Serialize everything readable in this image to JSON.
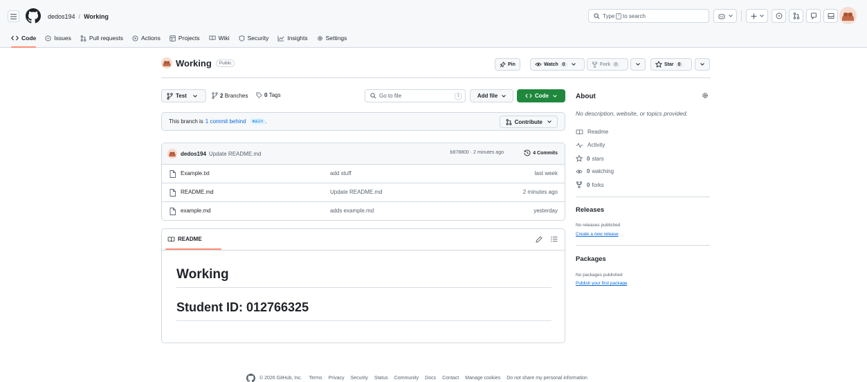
{
  "header": {
    "owner": "dedos194",
    "separator": "/",
    "repo": "Working",
    "search_prefix": "Type",
    "search_key": "/",
    "search_suffix": "to search"
  },
  "nav": {
    "code": "Code",
    "issues": "Issues",
    "pull_requests": "Pull requests",
    "actions": "Actions",
    "projects": "Projects",
    "wiki": "Wiki",
    "security": "Security",
    "insights": "Insights",
    "settings": "Settings"
  },
  "repo": {
    "name": "Working",
    "visibility": "Public",
    "pin_label": "Pin",
    "watch_label": "Watch",
    "watch_count": "0",
    "fork_label": "Fork",
    "fork_count": "0",
    "star_label": "Star",
    "star_count": "0"
  },
  "toolbar": {
    "branch": "Test",
    "branches_count": "2",
    "branches_label": "Branches",
    "tags_count": "0",
    "tags_label": "Tags",
    "goto_placeholder": "Go to file",
    "goto_key": "t",
    "add_file": "Add file",
    "code_label": "Code"
  },
  "behind_banner": {
    "prefix": "This branch is",
    "link": "1 commit behind",
    "branch": "main",
    "suffix": ".",
    "contribute": "Contribute"
  },
  "latest_commit": {
    "author": "dedos194",
    "message": "Update README.md",
    "meta": "b878800 · 2 minutes ago",
    "commits_count": "4",
    "commits_label": "Commits"
  },
  "files": [
    {
      "name": "Example.txt",
      "message": "add stuff",
      "date": "last week"
    },
    {
      "name": "README.md",
      "message": "Update README.md",
      "date": "2 minutes ago"
    },
    {
      "name": "example.md",
      "message": "adds example.md",
      "date": "yesterday"
    }
  ],
  "readme": {
    "tab": "README",
    "h1": "Working",
    "h2": "Student ID: 012766325"
  },
  "sidebar": {
    "about_title": "About",
    "about_desc": "No description, website, or topics provided.",
    "readme": "Readme",
    "activity": "Activity",
    "stars_count": "0",
    "stars_label": "stars",
    "watching_count": "0",
    "watching_label": "watching",
    "forks_count": "0",
    "forks_label": "forks",
    "releases_title": "Releases",
    "releases_none": "No releases published",
    "releases_link": "Create a new release",
    "packages_title": "Packages",
    "packages_none": "No packages published",
    "packages_link": "Publish your first package"
  },
  "footer": {
    "copyright": "© 2026 GitHub, Inc.",
    "links": [
      "Terms",
      "Privacy",
      "Security",
      "Status",
      "Community",
      "Docs",
      "Contact",
      "Manage cookies",
      "Do not share my personal information"
    ]
  },
  "colors": {
    "accent_link": "#0969da",
    "code_button": "#1f883d",
    "active_underline": "#fd8c73",
    "border": "#d1d9e0",
    "header_bg": "#f6f8fa"
  }
}
